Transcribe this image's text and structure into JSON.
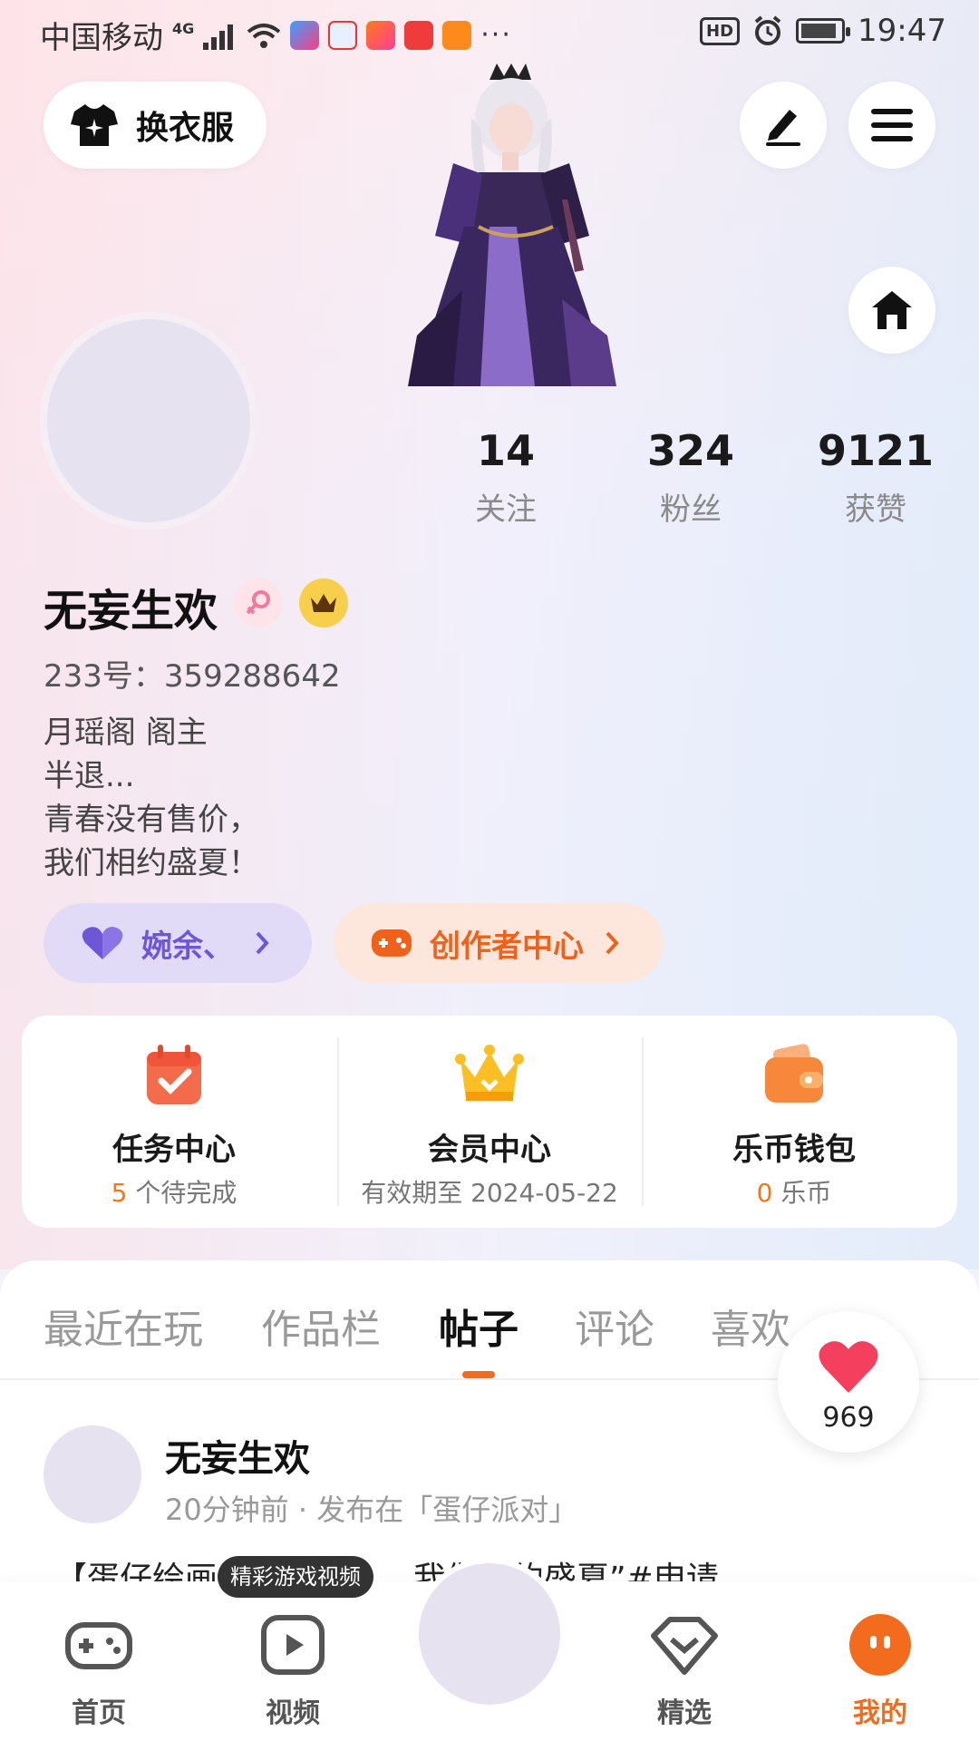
{
  "statusbar": {
    "carrier": "中国移动",
    "network": "4G",
    "time": "19:47",
    "hd": "HD",
    "more": "···"
  },
  "top": {
    "outfit_button": "换衣服"
  },
  "stats": [
    {
      "num": "14",
      "label": "关注"
    },
    {
      "num": "324",
      "label": "粉丝"
    },
    {
      "num": "9121",
      "label": "获赞"
    }
  ],
  "profile": {
    "name": "无妄生欢",
    "uid": "233号：359288642",
    "bio": [
      "月瑶阁 阁主",
      "半退...",
      "青春没有售价，",
      "我们相约盛夏！"
    ]
  },
  "pills": {
    "guild": "婉余、",
    "creator": "创作者中心"
  },
  "services": [
    {
      "title": "任务中心",
      "highlight": "5",
      "sub": " 个待完成"
    },
    {
      "title": "会员中心",
      "highlight": "",
      "sub": "有效期至 2024-05-22"
    },
    {
      "title": "乐币钱包",
      "highlight": "0",
      "sub": " 乐币"
    }
  ],
  "tabs": [
    "最近在玩",
    "作品栏",
    "帖子",
    "评论",
    "喜欢"
  ],
  "active_tab": "帖子",
  "like_count": "969",
  "post": {
    "author": "无妄生欢",
    "meta": "20分钟前 · 发布在「蛋仔派对」",
    "text": "【蛋仔绘画……没有……我们相约盛夏”#申请"
  },
  "tooltip": "精彩游戏视频",
  "nav": [
    {
      "label": "首页",
      "icon": "gamepad-icon"
    },
    {
      "label": "视频",
      "icon": "video-icon"
    },
    {
      "label": "精选",
      "icon": "heart-gem-icon"
    },
    {
      "label": "我的",
      "icon": "profile-face-icon"
    }
  ],
  "colors": {
    "accent": "#f36b1c",
    "guild_text": "#6e57d6",
    "guild_bg": "#e1dbf7",
    "creator_bg": "#fde7dc"
  }
}
